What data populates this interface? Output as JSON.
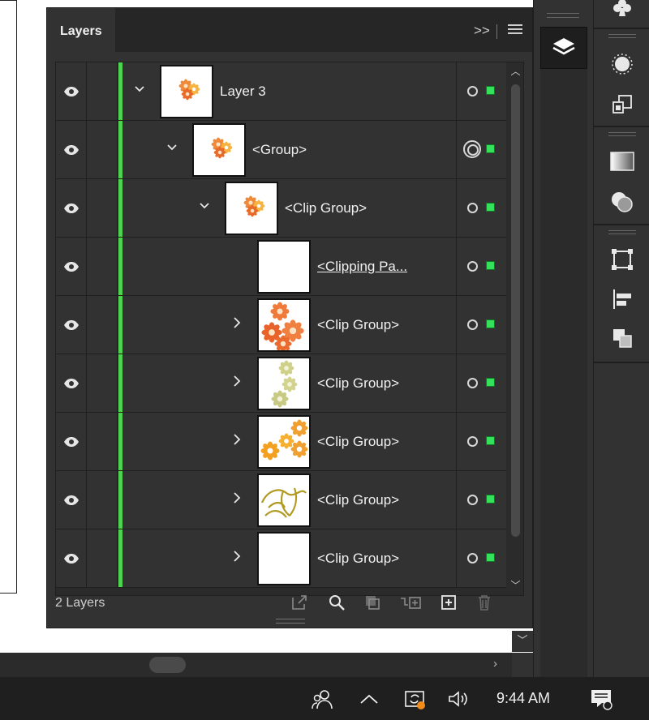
{
  "panel": {
    "title": "Layers",
    "expand_label": ">>",
    "menu_icon": "hamburger-menu-icon",
    "footer_count": "2 Layers",
    "footer_buttons": [
      "export-icon",
      "search-icon",
      "clip-mask-icon",
      "sublayer-icon",
      "new-layer-icon",
      "trash-icon"
    ]
  },
  "rows": [
    {
      "name": "Layer 3",
      "chevron": "⌄",
      "target": "single",
      "thumb": "flowers-small"
    },
    {
      "name": "<Group>",
      "chevron": "⌄",
      "target": "double",
      "thumb": "flowers-small"
    },
    {
      "name": "<Clip Group>",
      "chevron": "⌄",
      "target": "single",
      "thumb": "flowers-small"
    },
    {
      "name": "<Clipping Pa...",
      "chevron": "",
      "target": "single",
      "thumb": "blank",
      "underline": true
    },
    {
      "name": "<Clip Group>",
      "chevron": "›",
      "target": "single",
      "thumb": "orange-flowers"
    },
    {
      "name": "<Clip Group>",
      "chevron": "›",
      "target": "single",
      "thumb": "green-flowers"
    },
    {
      "name": "<Clip Group>",
      "chevron": "›",
      "target": "single",
      "thumb": "yellow-flowers"
    },
    {
      "name": "<Clip Group>",
      "chevron": "›",
      "target": "single",
      "thumb": "olive-lines"
    },
    {
      "name": "<Clip Group>",
      "chevron": "›",
      "target": "single",
      "thumb": "blank"
    }
  ],
  "colors": {
    "layer_color": "#4fd34f",
    "selection": "#35e05a",
    "panel": "#323232"
  },
  "taskbar": {
    "time": "9:44 AM"
  }
}
